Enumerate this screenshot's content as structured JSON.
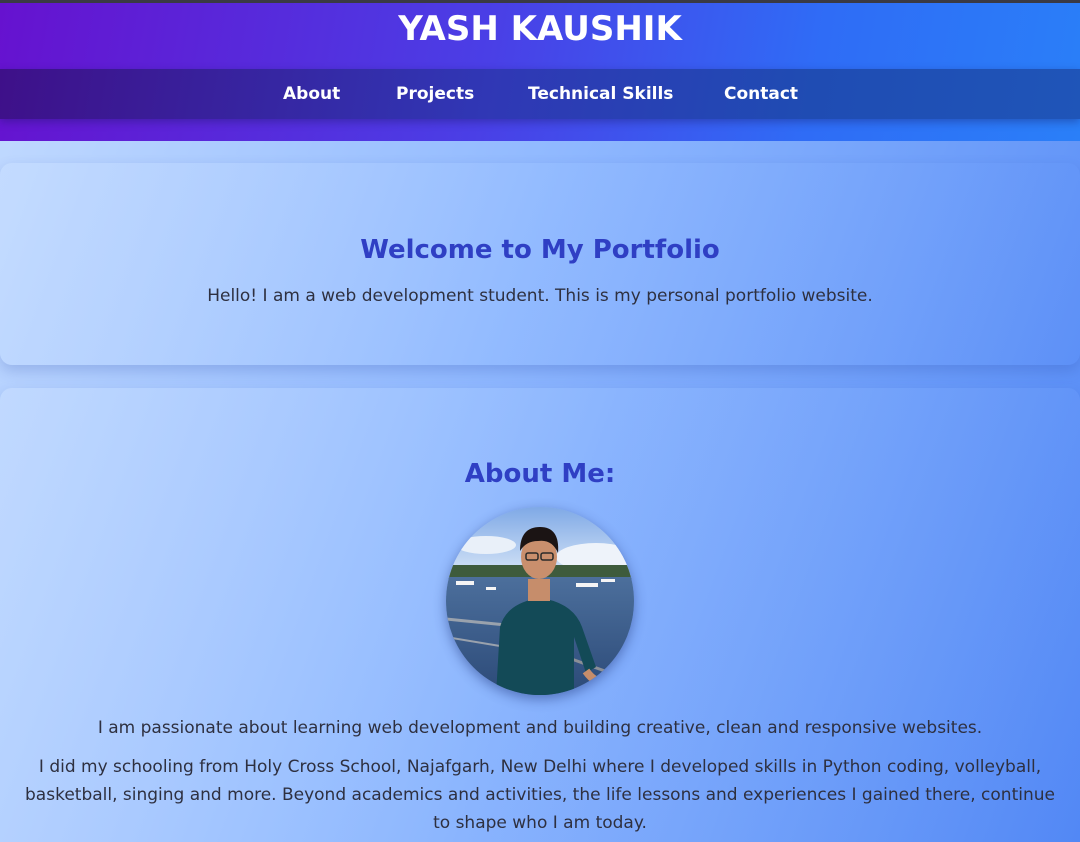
{
  "header": {
    "title": "YASH KAUSHIK"
  },
  "nav": {
    "items": [
      {
        "label": "About"
      },
      {
        "label": "Projects"
      },
      {
        "label": "Technical Skills"
      },
      {
        "label": "Contact"
      }
    ]
  },
  "welcome": {
    "heading": "Welcome to My Portfolio",
    "text": "Hello! I am a web development student. This is my personal portfolio website."
  },
  "about": {
    "heading": "About Me:",
    "photo_icon": "profile-photo",
    "paragraph1": "I am passionate about learning web development and building creative, clean and responsive websites.",
    "paragraph2": "I did my schooling from Holy Cross School, Najafgarh, New Delhi where I developed skills in Python coding, volleyball, basketball, singing and more. Beyond academics and activities, the life lessons and experiences I gained there, continue to shape who I am today."
  },
  "colors": {
    "heading": "#2f3fc4",
    "header_start": "#6612cf",
    "header_end": "#2a7ff8"
  }
}
